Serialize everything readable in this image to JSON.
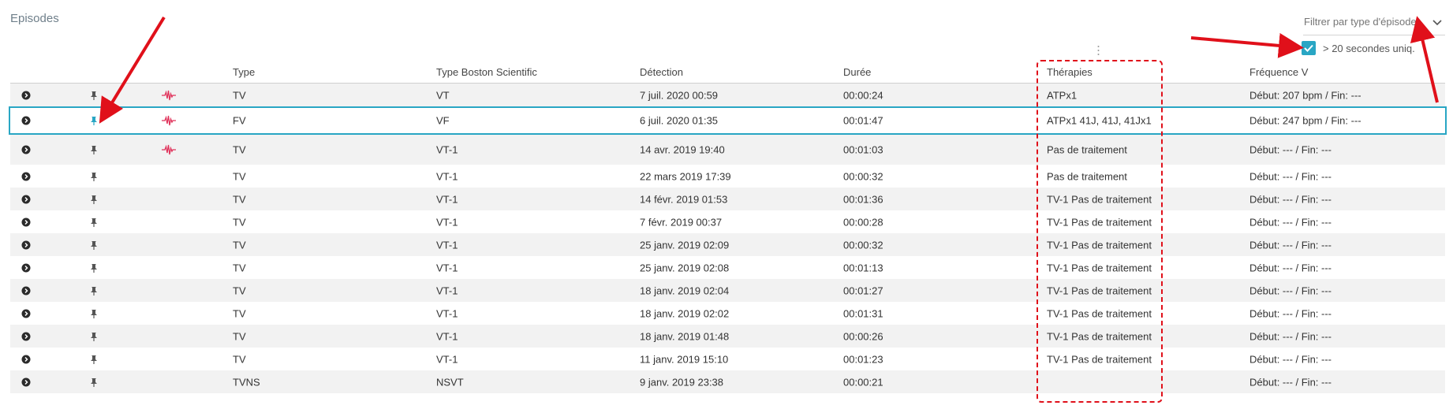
{
  "page": {
    "title": "Episodes"
  },
  "filter": {
    "placeholder": "Filtrer par type d'épisode"
  },
  "option": {
    "label": "> 20 secondes uniq.",
    "checked": true
  },
  "columns": {
    "type": "Type",
    "bsc_type": "Type Boston Scientific",
    "detection": "Détection",
    "duration": "Durée",
    "therapies": "Thérapies",
    "frequency": "Fréquence V"
  },
  "icons": {
    "expand": "chevron-right-circle-icon",
    "pin": "pin-icon",
    "egm": "waveform-icon"
  },
  "colors": {
    "accent": "#29a6c4",
    "egm": "#e0335b",
    "annotation": "#e0101a"
  },
  "rows": [
    {
      "type": "TV",
      "bsc": "VT",
      "detection": "7 juil. 2020 00:59",
      "duration": "00:00:24",
      "therapies": "ATPx1",
      "frequency": "Début: 207 bpm / Fin: ---",
      "egm": true,
      "pinned": false,
      "selected": false
    },
    {
      "type": "FV",
      "bsc": "VF",
      "detection": "6 juil. 2020 01:35",
      "duration": "00:01:47",
      "therapies": "ATPx1 41J, 41J, 41Jx1",
      "frequency": "Début: 247 bpm / Fin: ---",
      "egm": true,
      "pinned": true,
      "selected": true
    },
    {
      "type": "TV",
      "bsc": "VT-1",
      "detection": "14 avr. 2019 19:40",
      "duration": "00:01:03",
      "therapies": "Pas de traitement",
      "frequency": "Début: --- / Fin: ---",
      "egm": true,
      "pinned": false,
      "selected": false
    },
    {
      "type": "TV",
      "bsc": "VT-1",
      "detection": "22 mars 2019 17:39",
      "duration": "00:00:32",
      "therapies": "Pas de traitement",
      "frequency": "Début: --- / Fin: ---",
      "egm": false,
      "pinned": false,
      "selected": false
    },
    {
      "type": "TV",
      "bsc": "VT-1",
      "detection": "14 févr. 2019 01:53",
      "duration": "00:01:36",
      "therapies": "TV-1 Pas de traitement",
      "frequency": "Début: --- / Fin: ---",
      "egm": false,
      "pinned": false,
      "selected": false
    },
    {
      "type": "TV",
      "bsc": "VT-1",
      "detection": "7 févr. 2019 00:37",
      "duration": "00:00:28",
      "therapies": "TV-1 Pas de traitement",
      "frequency": "Début: --- / Fin: ---",
      "egm": false,
      "pinned": false,
      "selected": false
    },
    {
      "type": "TV",
      "bsc": "VT-1",
      "detection": "25 janv. 2019 02:09",
      "duration": "00:00:32",
      "therapies": "TV-1 Pas de traitement",
      "frequency": "Début: --- / Fin: ---",
      "egm": false,
      "pinned": false,
      "selected": false
    },
    {
      "type": "TV",
      "bsc": "VT-1",
      "detection": "25 janv. 2019 02:08",
      "duration": "00:01:13",
      "therapies": "TV-1 Pas de traitement",
      "frequency": "Début: --- / Fin: ---",
      "egm": false,
      "pinned": false,
      "selected": false
    },
    {
      "type": "TV",
      "bsc": "VT-1",
      "detection": "18 janv. 2019 02:04",
      "duration": "00:01:27",
      "therapies": "TV-1 Pas de traitement",
      "frequency": "Début: --- / Fin: ---",
      "egm": false,
      "pinned": false,
      "selected": false
    },
    {
      "type": "TV",
      "bsc": "VT-1",
      "detection": "18 janv. 2019 02:02",
      "duration": "00:01:31",
      "therapies": "TV-1 Pas de traitement",
      "frequency": "Début: --- / Fin: ---",
      "egm": false,
      "pinned": false,
      "selected": false
    },
    {
      "type": "TV",
      "bsc": "VT-1",
      "detection": "18 janv. 2019 01:48",
      "duration": "00:00:26",
      "therapies": "TV-1 Pas de traitement",
      "frequency": "Début: --- / Fin: ---",
      "egm": false,
      "pinned": false,
      "selected": false
    },
    {
      "type": "TV",
      "bsc": "VT-1",
      "detection": "11 janv. 2019 15:10",
      "duration": "00:01:23",
      "therapies": "TV-1 Pas de traitement",
      "frequency": "Début: --- / Fin: ---",
      "egm": false,
      "pinned": false,
      "selected": false
    },
    {
      "type": "TVNS",
      "bsc": "NSVT",
      "detection": "9 janv. 2019 23:38",
      "duration": "00:00:21",
      "therapies": "",
      "frequency": "Début: --- / Fin: ---",
      "egm": false,
      "pinned": false,
      "selected": false
    }
  ]
}
